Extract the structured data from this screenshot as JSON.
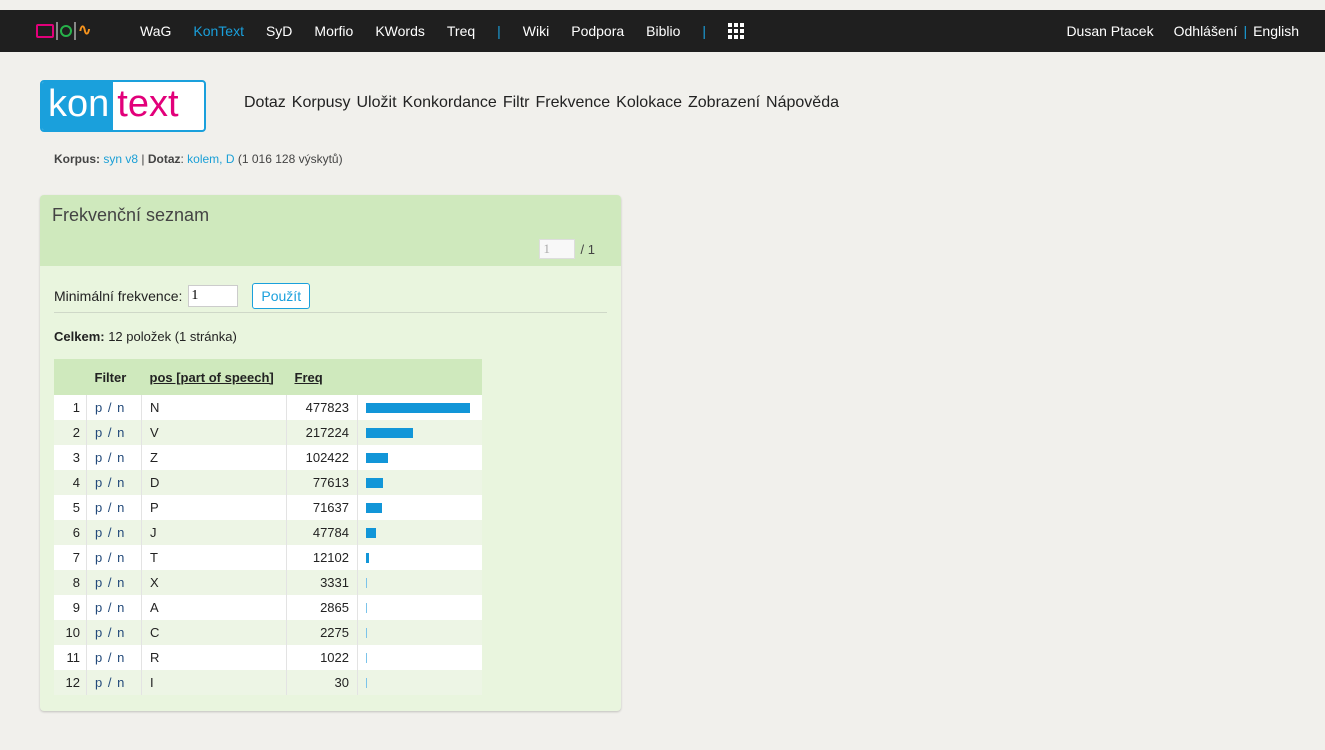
{
  "topbar": {
    "nav": [
      "WaG",
      "KonText",
      "SyD",
      "Morfio",
      "KWords",
      "Treq",
      "Wiki",
      "Podpora",
      "Biblio"
    ],
    "user": "Dusan Ptacek",
    "logout": "Odhlášení",
    "language": "English"
  },
  "logo": {
    "kon": "kon",
    "text": "text"
  },
  "menu": [
    "Dotaz",
    "Korpusy",
    "Uložit",
    "Konkordance",
    "Filtr",
    "Frekvence",
    "Kolokace",
    "Zobrazení",
    "Nápověda"
  ],
  "query_info": {
    "corpus_label": "Korpus:",
    "corpus": "syn v8",
    "query_label": "Dotaz",
    "query": "kolem, D",
    "hits": "(1 016 128 výskytů)"
  },
  "panel": {
    "title": "Frekvenční seznam",
    "page_value": "1",
    "page_total": "/ 1",
    "minfreq_label": "Minimální frekvence:",
    "minfreq_value": "1",
    "apply": "Použít",
    "total_label": "Celkem:",
    "total_text": "12 položek (1 stránka)"
  },
  "table": {
    "headers": {
      "filter": "Filter",
      "pos": "pos [part of speech]",
      "freq": "Freq"
    },
    "filter_text": "p / n",
    "rows": [
      {
        "n": "1",
        "pos": "N",
        "freq": 477823
      },
      {
        "n": "2",
        "pos": "V",
        "freq": 217224
      },
      {
        "n": "3",
        "pos": "Z",
        "freq": 102422
      },
      {
        "n": "4",
        "pos": "D",
        "freq": 77613
      },
      {
        "n": "5",
        "pos": "P",
        "freq": 71637
      },
      {
        "n": "6",
        "pos": "J",
        "freq": 47784
      },
      {
        "n": "7",
        "pos": "T",
        "freq": 12102
      },
      {
        "n": "8",
        "pos": "X",
        "freq": 3331
      },
      {
        "n": "9",
        "pos": "A",
        "freq": 2865
      },
      {
        "n": "10",
        "pos": "C",
        "freq": 2275
      },
      {
        "n": "11",
        "pos": "R",
        "freq": 1022
      },
      {
        "n": "12",
        "pos": "I",
        "freq": 30
      }
    ]
  },
  "colors": {
    "accent": "#1aa0dc",
    "logo_text": "#e2007a",
    "panel_header": "#cfe9bd",
    "bar": "#1296d8"
  }
}
